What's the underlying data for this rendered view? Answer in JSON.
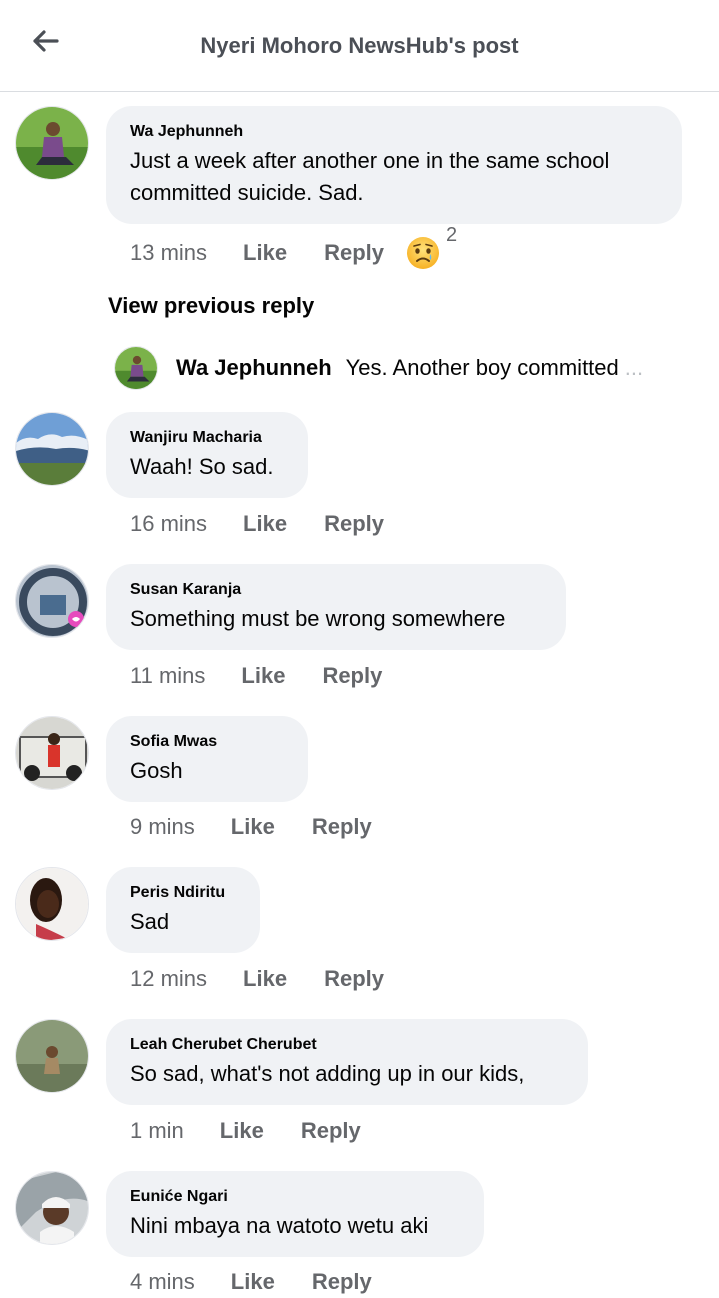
{
  "header": {
    "title": "Nyeri Mohoro NewsHub's post"
  },
  "labels": {
    "like": "Like",
    "reply": "Reply"
  },
  "comments": [
    {
      "author": "Wa Jephunneh",
      "text": "Just a week after another one in the same school committed suicide. Sad.",
      "time": "13 mins",
      "reaction": {
        "icon": "sad-emoji",
        "count": "2"
      }
    },
    {
      "author": "Wanjiru Macharia",
      "text": "Waah! So sad.",
      "time": "16 mins"
    },
    {
      "author": "Susan Karanja",
      "text": "Something must be wrong somewhere",
      "time": "11 mins"
    },
    {
      "author": "Sofia Mwas",
      "text": "Gosh",
      "time": "9 mins"
    },
    {
      "author": "Peris Ndiritu",
      "text": "Sad",
      "time": "12 mins"
    },
    {
      "author": "Leah Cherubet Cherubet",
      "text": "So sad, what's not adding up in our kids,",
      "time": "1 min"
    },
    {
      "author": "Euniće Ngari",
      "text": "Nini mbaya na watoto wetu aki",
      "time": "4 mins"
    }
  ],
  "thread": {
    "view_previous": "View previous reply",
    "reply": {
      "author": "Wa Jephunneh",
      "text": "Yes. Another boy committed",
      "ellipsis": "..."
    }
  },
  "colors": {
    "bubble": "#f0f2f5",
    "meta": "#65676b",
    "text": "#050505"
  }
}
